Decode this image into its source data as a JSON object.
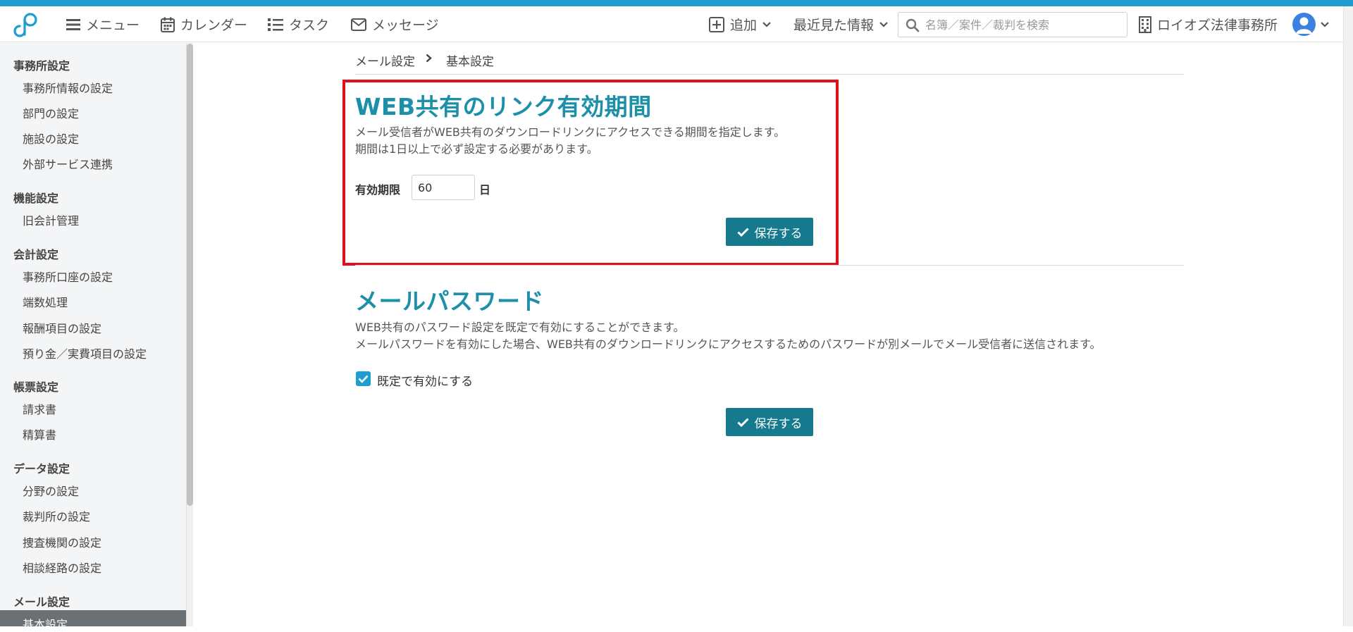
{
  "header": {
    "menu_label": "メニュー",
    "calendar_label": "カレンダー",
    "task_label": "タスク",
    "message_label": "メッセージ",
    "add_label": "追加",
    "recent_label": "最近見た情報",
    "search_placeholder": "名簿／案件／裁判を検索",
    "office_name": "ロイオズ法律事務所"
  },
  "sidebar": {
    "sections": [
      {
        "heading": "事務所設定",
        "items": [
          "事務所情報の設定",
          "部門の設定",
          "施設の設定",
          "外部サービス連携"
        ]
      },
      {
        "heading": "機能設定",
        "items": [
          "旧会計管理"
        ]
      },
      {
        "heading": "会計設定",
        "items": [
          "事務所口座の設定",
          "端数処理",
          "報酬項目の設定",
          "預り金／実費項目の設定"
        ]
      },
      {
        "heading": "帳票設定",
        "items": [
          "請求書",
          "精算書"
        ]
      },
      {
        "heading": "データ設定",
        "items": [
          "分野の設定",
          "裁判所の設定",
          "捜査機関の設定",
          "相談経路の設定"
        ]
      },
      {
        "heading": "メール設定",
        "items": [
          "基本設定"
        ]
      }
    ],
    "active_item": "基本設定"
  },
  "breadcrumb": {
    "parent": "メール設定",
    "current": "基本設定"
  },
  "link_expiry": {
    "title": "WEB共有のリンク有効期間",
    "desc1": "メール受信者がWEB共有のダウンロードリンクにアクセスできる期間を指定します。",
    "desc2": "期間は1日以上で必ず設定する必要があります。",
    "field_label": "有効期限",
    "value": "60",
    "unit": "日",
    "save_label": "保存する"
  },
  "mail_password": {
    "title": "メールパスワード",
    "desc1": "WEB共有のパスワード設定を既定で有効にすることができます。",
    "desc2": "メールパスワードを有効にした場合、WEB共有のダウンロードリンクにアクセスするためのパスワードが別メールでメール受信者に送信されます。",
    "checkbox_label": "既定で有効にする",
    "checked": true,
    "save_label": "保存する"
  },
  "colors": {
    "accent": "#1c8fa9",
    "button": "#157a8e",
    "topline": "#1e9ed0",
    "highlight_border": "#e2101a"
  }
}
